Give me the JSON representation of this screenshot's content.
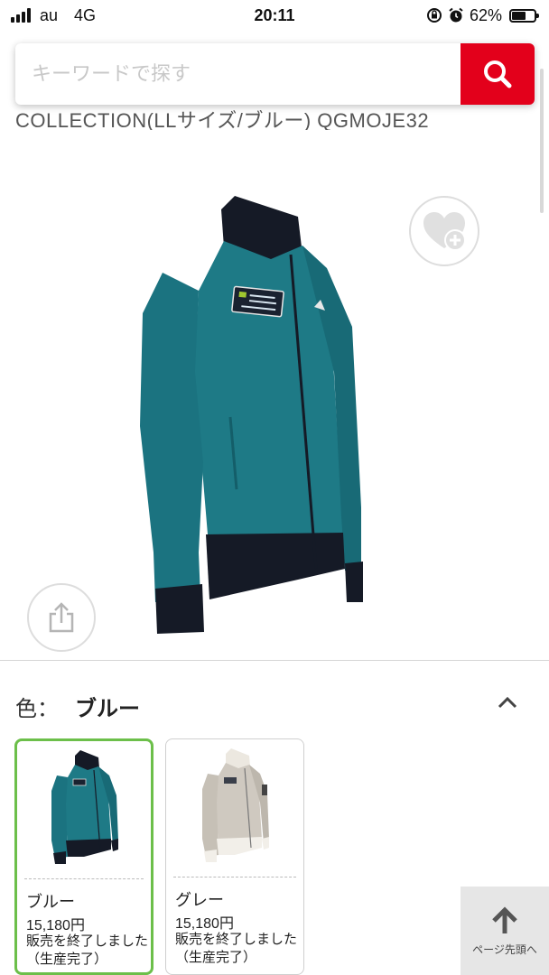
{
  "status_bar": {
    "carrier": "au",
    "network": "4G",
    "time": "20:11",
    "battery": "62%",
    "battery_level": 0.62
  },
  "search": {
    "placeholder": "キーワードで探す"
  },
  "product": {
    "title_fragment": "COLLECTION(LLサイズ/ブルー) QGMOJE32"
  },
  "color_selector": {
    "label": "色：",
    "selected": "ブルー"
  },
  "variants": [
    {
      "name": "ブルー",
      "price": "15,180円",
      "status": "販売を終了しました（生産完了）",
      "color": "#1e7a86"
    },
    {
      "name": "グレー",
      "price": "15,180円",
      "status": "販売を終了しました（生産完了）",
      "color": "#cfc9c0"
    }
  ],
  "back_to_top": {
    "label": "ページ先頭へ"
  },
  "colors": {
    "accent_red": "#e3001b",
    "selected_border": "#6cbf4a",
    "jacket_teal": "#1e7a86",
    "jacket_navy": "#151a26"
  }
}
